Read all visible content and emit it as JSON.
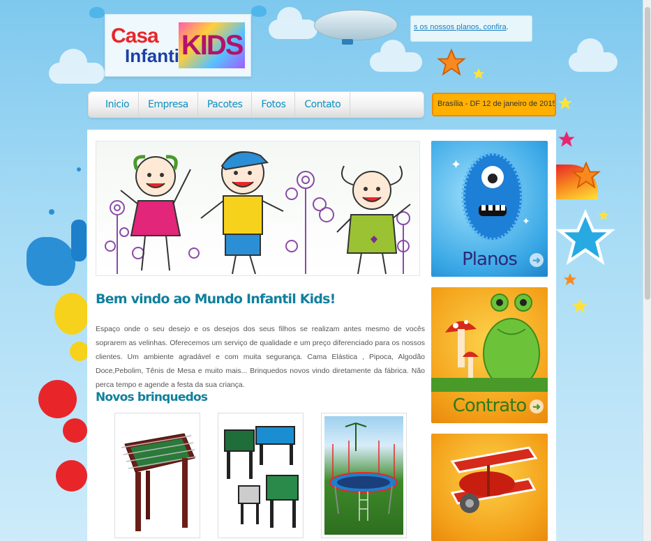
{
  "header": {
    "logo": {
      "line1": "Casa",
      "line2": "Infantil",
      "kids": "KIDS"
    },
    "promo": {
      "link_text": "s os nossos planos, confira",
      "suffix": "."
    },
    "date_text": "Brasília - DF 12 de janeiro de 2015 |"
  },
  "nav": {
    "items": [
      {
        "label": "Inicio"
      },
      {
        "label": "Empresa"
      },
      {
        "label": "Pacotes"
      },
      {
        "label": "Fotos"
      },
      {
        "label": "Contato"
      }
    ]
  },
  "main": {
    "welcome_title": "Bem vindo ao Mundo Infantil Kids!",
    "intro_text": "Espaço onde o seu desejo e os desejos dos seus filhos se realizam antes mesmo de vocês soprarem as velinhas. Oferecemos um serviço de qualidade e um preço diferenciado para os nossos clientes. Um ambiente agradável e com muita segurança. Cama Elástica , Pipoca, Algodão Doce,Pebolim, Tênis de Mesa e muito mais... Brinquedos novos vindo diretamente da fábrica. Não perca tempo e agende a festa da sua criança.",
    "new_toys_title": "Novos brinquedos"
  },
  "sidebar": {
    "tiles": [
      {
        "label": "Planos"
      },
      {
        "label": "Contrato"
      }
    ]
  },
  "colors": {
    "accent": "#11809e",
    "nav_text": "#0a8fc1",
    "date_bg": "#ffb000"
  }
}
